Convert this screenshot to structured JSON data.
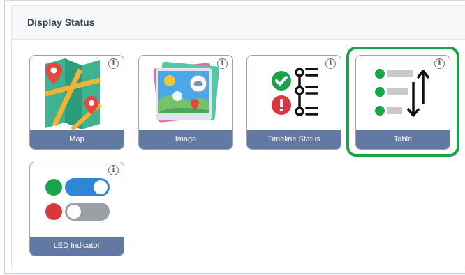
{
  "section": {
    "title": "Display Status"
  },
  "cards": [
    {
      "label": "Map",
      "icon": "map-icon"
    },
    {
      "label": "Image",
      "icon": "image-icon"
    },
    {
      "label": "Timeline Status",
      "icon": "timeline-status-icon"
    },
    {
      "label": "Table",
      "icon": "table-sort-icon",
      "selected": true
    },
    {
      "label": "LED Indicator",
      "icon": "led-indicator-icon"
    }
  ],
  "info_glyph": "i",
  "colors": {
    "label_bg": "#627aa3",
    "selection_outline": "#1aa34a",
    "green": "#1aa34a",
    "red": "#d9363e",
    "toggle_blue": "#2f86d6",
    "toggle_gray": "#9aa0a6"
  }
}
